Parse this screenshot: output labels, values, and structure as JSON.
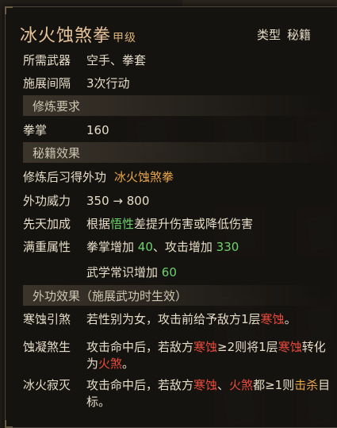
{
  "skill": {
    "name": "冰火蚀煞拳",
    "grade": "甲级",
    "type_label": "类型",
    "type_value": "秘籍"
  },
  "stats": [
    {
      "key": "所需武器",
      "value": "空手、拳套"
    },
    {
      "key": "施展间隔",
      "value": "3次行动"
    }
  ],
  "sections": {
    "requirements": "修炼要求",
    "effects": "秘籍效果",
    "external": "外功效果（施展武功时生效）"
  },
  "requirements": [
    {
      "key": "拳掌",
      "value": "160"
    }
  ],
  "learn": {
    "key": "修炼后习得外功",
    "value": "冰火蚀煞拳"
  },
  "power": {
    "key": "外功威力",
    "value": "350 → 800"
  },
  "innate": {
    "key": "先天加成",
    "pre": "根据",
    "hl": "悟性",
    "post": "差提升伤害或降低伤害"
  },
  "full": {
    "key": "满重属性",
    "line1_a": "拳掌增加 ",
    "line1_b": "40",
    "line1_c": "、攻击增加 ",
    "line1_d": "330",
    "line2_a": "武学常识增加 ",
    "line2_b": "60"
  },
  "external_effects": [
    {
      "key": "寒蚀引煞",
      "parts": [
        {
          "t": "若性别为女，攻击前给予敌方1层",
          "c": ""
        },
        {
          "t": "寒蚀",
          "c": "red"
        },
        {
          "t": "。",
          "c": ""
        }
      ]
    },
    {
      "key": "蚀凝煞生",
      "parts": [
        {
          "t": "攻击命中后，若敌方",
          "c": ""
        },
        {
          "t": "寒蚀",
          "c": "red"
        },
        {
          "t": "≥2则将1层",
          "c": ""
        },
        {
          "t": "寒蚀",
          "c": "red"
        },
        {
          "t": "转化为",
          "c": ""
        },
        {
          "t": "火煞",
          "c": "red"
        },
        {
          "t": "。",
          "c": ""
        }
      ]
    },
    {
      "key": "冰火寂灭",
      "parts": [
        {
          "t": "攻击命中后，若敌方",
          "c": ""
        },
        {
          "t": "寒蚀",
          "c": "red"
        },
        {
          "t": "、",
          "c": ""
        },
        {
          "t": "火煞",
          "c": "red"
        },
        {
          "t": "都≥1则",
          "c": ""
        },
        {
          "t": "击杀",
          "c": "orange"
        },
        {
          "t": "目标。",
          "c": ""
        }
      ]
    }
  ]
}
